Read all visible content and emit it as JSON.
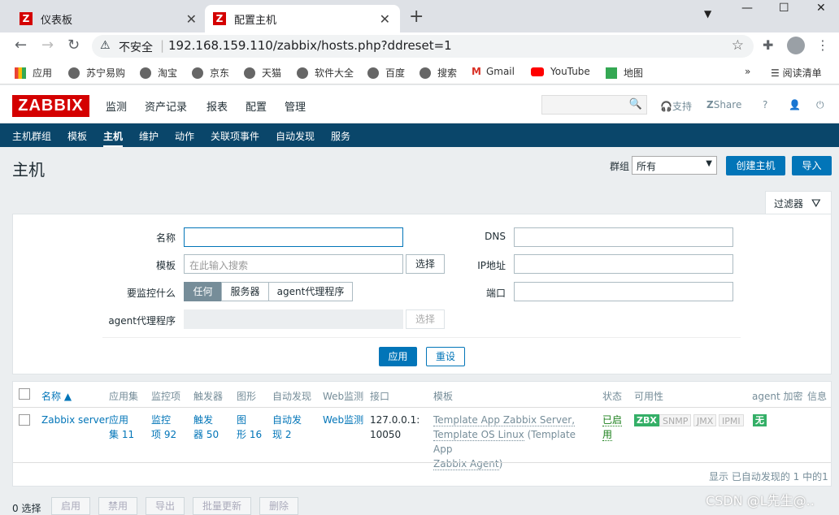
{
  "browser": {
    "tabs": [
      {
        "label": "仪表板"
      },
      {
        "label": "配置主机"
      }
    ],
    "address": {
      "security": "不安全",
      "url": "192.168.159.110/zabbix/hosts.php?ddreset=1"
    },
    "bookmarks": [
      "应用",
      "苏宁易购",
      "淘宝",
      "京东",
      "天猫",
      "软件大全",
      "百度",
      "搜索",
      "Gmail",
      "YouTube",
      "地图"
    ],
    "reading_list": "阅读清单"
  },
  "zabbix": {
    "logo": "ZABBIX",
    "main_menu": [
      "监测",
      "资产记录",
      "报表",
      "配置",
      "管理"
    ],
    "support": "支持",
    "share": "Share",
    "help": "?",
    "sub_menu": [
      "主机群组",
      "模板",
      "主机",
      "维护",
      "动作",
      "关联项事件",
      "自动发现",
      "服务"
    ],
    "page_title": "主机",
    "group_label": "群组",
    "group_value": "所有",
    "create_host": "创建主机",
    "import": "导入",
    "filter_tab": "过滤器",
    "filter": {
      "name_label": "名称",
      "template_label": "模板",
      "template_placeholder": "在此输入搜索",
      "select": "选择",
      "monitored_by_label": "要监控什么",
      "seg_any": "任何",
      "seg_server": "服务器",
      "seg_proxy": "agent代理程序",
      "proxy_label": "agent代理程序",
      "select2": "选择",
      "dns_label": "DNS",
      "ip_label": "IP地址",
      "port_label": "端口",
      "apply": "应用",
      "reset": "重设"
    },
    "table": {
      "headers": [
        "名称 ▲",
        "应用集",
        "监控项",
        "触发器",
        "图形",
        "自动发现",
        "Web监测",
        "接口",
        "模板",
        "状态",
        "可用性",
        "agent 加密",
        "信息"
      ],
      "row": {
        "name": "Zabbix server",
        "apps_a": "应用",
        "apps_b": "集 11",
        "items_a": "监控",
        "items_b": "项 92",
        "triggers_a": "触发",
        "triggers_b": "器 50",
        "graphs_a": "图",
        "graphs_b": "形 16",
        "discovery_a": "自动发",
        "discovery_b": "现 2",
        "web": "Web监测",
        "iface_a": "127.0.0.1:",
        "iface_b": "10050",
        "tmpl1": "Template App Zabbix Server,",
        "tmpl2": "Template OS Linux",
        "tmpl3a": "(Template App",
        "tmpl3b": "Zabbix Agent",
        "tmpl3c": ")",
        "status_a": "已启",
        "status_b": "用",
        "zbx": "ZBX",
        "snmp": "SNMP",
        "jmx": "JMX",
        "ipmi": "IPMI",
        "enc": "无"
      },
      "footer": "显示 已自动发现的 1 中的1"
    },
    "bottom": {
      "selected": "0 选择",
      "enable": "启用",
      "disable": "禁用",
      "export": "导出",
      "mass_update": "批量更新",
      "delete": "删除"
    },
    "watermark": "CSDN @L先生@.."
  },
  "colors": {
    "brand": "#d40000",
    "nav": "#0a466a",
    "primary": "#0275b8",
    "success": "#34af67"
  }
}
